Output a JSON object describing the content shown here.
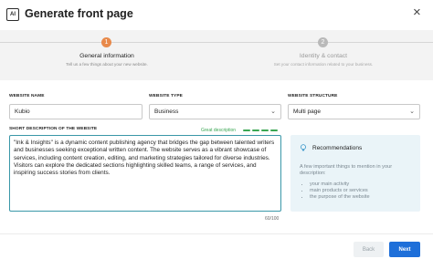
{
  "header": {
    "logo_text": "AI",
    "title": "Generate front page",
    "close_glyph": "×"
  },
  "steps": [
    {
      "number": "1",
      "title": "General information",
      "subtitle": "Tell us a few things about your new website.",
      "state": "active",
      "color": "#e8894a"
    },
    {
      "number": "2",
      "title": "Identity & contact",
      "subtitle": "Set your contact information related to your business.",
      "state": "inactive",
      "color": "#b9b9b9"
    }
  ],
  "form": {
    "website_name": {
      "label": "WEBSITE NAME",
      "value": "Kubio"
    },
    "website_type": {
      "label": "WEBSITE TYPE",
      "value": "Business",
      "icon": "chevron-down-icon"
    },
    "website_structure": {
      "label": "WEBSITE STRUCTURE",
      "value": "Multi page",
      "icon": "chevron-down-icon"
    },
    "description": {
      "label": "SHORT DESCRIPTION OF THE WEBSITE",
      "quality_label": "Great description",
      "quality_segments_filled": 4,
      "quality_color": "#3aa653",
      "value": "\"Ink & Insights\" is a dynamic content publishing agency that bridges the gap between talented writers and businesses seeking exceptional written content. The website serves as a vibrant showcase of services, including content creation, editing, and marketing strategies tailored for diverse industries. Visitors can explore the dedicated sections highlighting skilled teams, a range of services, and inspiring success stories from clients.",
      "counter": "60/100"
    }
  },
  "recommendations": {
    "icon": "lightbulb-icon",
    "title": "Recommendations",
    "text": "A few important things to mention in your description:",
    "items": [
      "your main activity",
      "main products or services",
      "the purpose of the website"
    ]
  },
  "footer": {
    "back_label": "Back",
    "next_label": "Next",
    "accent": "#1e6fd9"
  }
}
